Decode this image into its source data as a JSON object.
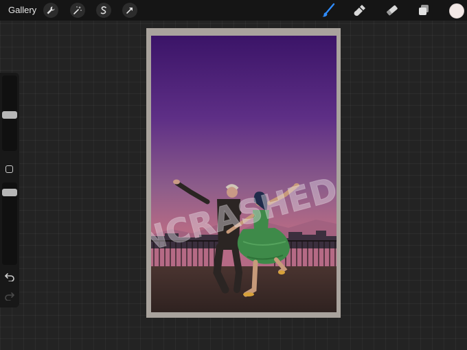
{
  "topbar": {
    "gallery_label": "Gallery",
    "left_tools": [
      "wrench-icon",
      "magic-wand-icon",
      "selection-icon",
      "transform-arrow-icon"
    ],
    "right_tools": [
      "brush-icon",
      "smudge-icon",
      "eraser-icon",
      "layers-icon"
    ],
    "active_tool": "brush",
    "current_color": "#f2e8e6"
  },
  "sidebar": {
    "brush_size_level": 0.4,
    "opacity_level": 1.0
  },
  "canvas": {
    "watermark_text": "UNCRASHED",
    "colors": {
      "sky_top": "#3b1468",
      "sky_mid": "#5e2f86",
      "sky_low": "#8d5d8a",
      "horizon": "#b56a85",
      "ground": "#3b2a26",
      "dress": "#3e8a49"
    }
  }
}
